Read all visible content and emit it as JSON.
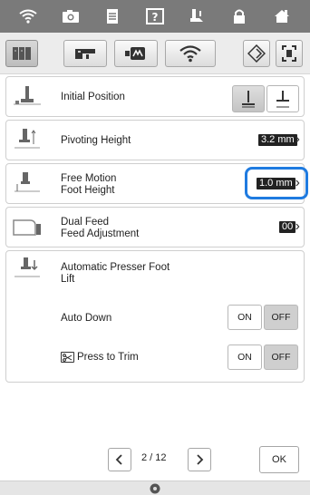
{
  "topbar": {
    "icons": [
      "wifi-icon",
      "camera-icon",
      "document-icon",
      "help-icon",
      "presser-foot-icon",
      "lock-icon",
      "home-icon"
    ]
  },
  "tabs": {
    "icons": [
      "sewing-settings-tab-icon",
      "machine-tab-icon",
      "embroidery-tab-icon",
      "wifi-tab-icon",
      "scan-icon",
      "frame-icon"
    ],
    "active_index": 0
  },
  "rows": {
    "initial_position": {
      "label": "Initial Position",
      "selected": "low"
    },
    "pivoting_height": {
      "label": "Pivoting Height",
      "value": "3.2 mm"
    },
    "free_motion": {
      "label_line1": "Free Motion",
      "label_line2": "Foot Height",
      "value": "1.0 mm"
    },
    "dual_feed": {
      "label_line1": "Dual Feed",
      "label_line2": "Feed Adjustment",
      "value": "00"
    },
    "auto_lift": {
      "label_line1": "Automatic Presser Foot",
      "label_line2": "Lift",
      "auto_down_label": "Auto Down",
      "press_to_trim_label": "Press to Trim",
      "on_label": "ON",
      "off_label": "OFF",
      "auto_down_state": "OFF",
      "press_to_trim_state": "OFF"
    }
  },
  "pagination": {
    "current": "2",
    "separator": "/",
    "total": "12",
    "text": "2 / 12"
  },
  "ok_label": "OK",
  "colors": {
    "topbar": "#7a7a7a",
    "highlight": "#1f7be0",
    "value_bg": "#222222"
  }
}
